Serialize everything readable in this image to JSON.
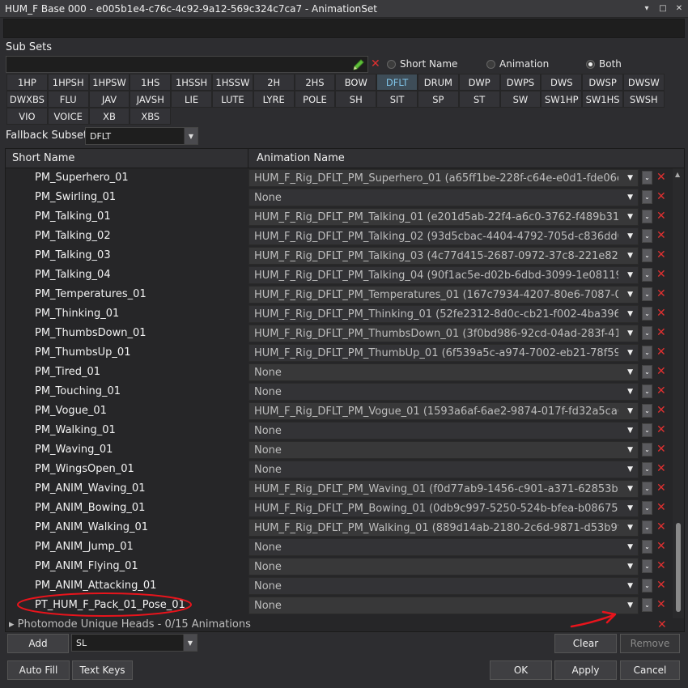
{
  "window": {
    "title": "HUM_F Base 000 - e005b1e4-c76c-4c92-9a12-569c324c7ca7 - AnimationSet",
    "controls": [
      "▾",
      "□",
      "✕"
    ]
  },
  "subsets": {
    "label": "Sub Sets",
    "input_value": "",
    "radios": [
      {
        "label": "Short Name",
        "selected": false
      },
      {
        "label": "Animation",
        "selected": false
      },
      {
        "label": "Both",
        "selected": true
      }
    ]
  },
  "tags": [
    [
      "1HP",
      "1HPSH",
      "1HPSW",
      "1HS",
      "1HSSH",
      "1HSSW",
      "2H",
      "2HS",
      "BOW",
      "DFLT",
      "DRUM",
      "DWP",
      "DWPS",
      "DWS",
      "DWSP",
      "DWSW"
    ],
    [
      "DWXBS",
      "FLU",
      "JAV",
      "JAVSH",
      "LIE",
      "LUTE",
      "LYRE",
      "POLE",
      "SH",
      "SIT",
      "SP",
      "ST",
      "SW",
      "SW1HP",
      "SW1HS",
      "SWSH"
    ],
    [
      "VIO",
      "VOICE",
      "XB",
      "XBS"
    ]
  ],
  "active_tag": "DFLT",
  "fallback": {
    "label": "Fallback Subset",
    "value": "DFLT"
  },
  "grid": {
    "col_short": "Short Name",
    "col_anim": "Animation Name",
    "rows": [
      {
        "short": "PM_Superhero_01",
        "anim": "HUM_F_Rig_DFLT_PM_Superhero_01 (a65ff1be-228f-c64e-e0d1-fde06d..."
      },
      {
        "short": "PM_Swirling_01",
        "anim": "None"
      },
      {
        "short": "PM_Talking_01",
        "anim": "HUM_F_Rig_DFLT_PM_Talking_01 (e201d5ab-22f4-a6c0-3762-f489b316..."
      },
      {
        "short": "PM_Talking_02",
        "anim": "HUM_F_Rig_DFLT_PM_Talking_02 (93d5cbac-4404-4792-705d-c836dd05..."
      },
      {
        "short": "PM_Talking_03",
        "anim": "HUM_F_Rig_DFLT_PM_Talking_03 (4c77d415-2687-0972-37c8-221e82a8..."
      },
      {
        "short": "PM_Talking_04",
        "anim": "HUM_F_Rig_DFLT_PM_Talking_04 (90f1ac5e-d02b-6dbd-3099-1e081193..."
      },
      {
        "short": "PM_Temperatures_01",
        "anim": "HUM_F_Rig_DFLT_PM_Temperatures_01 (167c7934-4207-80e6-7087-05..."
      },
      {
        "short": "PM_Thinking_01",
        "anim": "HUM_F_Rig_DFLT_PM_Thinking_01 (52fe2312-8d0c-cb21-f002-4ba396f4..."
      },
      {
        "short": "PM_ThumbsDown_01",
        "anim": "HUM_F_Rig_DFLT_PM_ThumbsDown_01 (3f0bd986-92cd-04ad-283f-411..."
      },
      {
        "short": "PM_ThumbsUp_01",
        "anim": "HUM_F_Rig_DFLT_PM_ThumbUp_01 (6f539a5c-a974-7002-eb21-78f594..."
      },
      {
        "short": "PM_Tired_01",
        "anim": "None"
      },
      {
        "short": "PM_Touching_01",
        "anim": "None"
      },
      {
        "short": "PM_Vogue_01",
        "anim": "HUM_F_Rig_DFLT_PM_Vogue_01 (1593a6af-6ae2-9874-017f-fd32a5ca67..."
      },
      {
        "short": "PM_Walking_01",
        "anim": "None"
      },
      {
        "short": "PM_Waving_01",
        "anim": "None"
      },
      {
        "short": "PM_WingsOpen_01",
        "anim": "None"
      },
      {
        "short": "PM_ANIM_Waving_01",
        "anim": "HUM_F_Rig_DFLT_PM_Waving_01 (f0d77ab9-1456-c901-a371-62853bed..."
      },
      {
        "short": "PM_ANIM_Bowing_01",
        "anim": "HUM_F_Rig_DFLT_PM_Bowing_01 (0db9c997-5250-524b-bfea-b086751..."
      },
      {
        "short": "PM_ANIM_Walking_01",
        "anim": "HUM_F_Rig_DFLT_PM_Walking_01 (889d14ab-2180-2c6d-9871-d53b9f8..."
      },
      {
        "short": "PM_ANIM_Jump_01",
        "anim": "None"
      },
      {
        "short": "PM_ANIM_Flying_01",
        "anim": "None"
      },
      {
        "short": "PM_ANIM_Attacking_01",
        "anim": "None"
      },
      {
        "short": "PT_HUM_F_Pack_01_Pose_01",
        "anim": "None"
      }
    ],
    "group_row": "Photomode Unique Heads - 0/15 Animations"
  },
  "bottom": {
    "add_label": "Add",
    "select_value": "SL",
    "clear_label": "Clear",
    "remove_label": "Remove",
    "autofill_label": "Auto Fill",
    "textkeys_label": "Text Keys",
    "ok_label": "OK",
    "apply_label": "Apply",
    "cancel_label": "Cancel"
  },
  "colors": {
    "background": "#2d2d30",
    "accent_active_tag": "#7fc4e8",
    "delete_red": "#e03030",
    "annotation_red": "#e8141c",
    "pencil_green": "#5fbf3a"
  }
}
